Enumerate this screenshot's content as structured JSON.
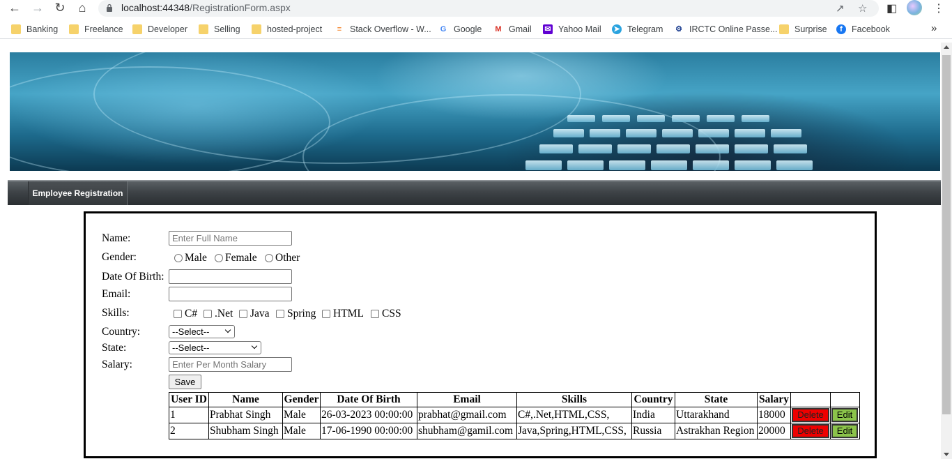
{
  "browser": {
    "url_host": "localhost:44348",
    "url_path": "/RegistrationForm.aspx",
    "bookmarks": [
      {
        "label": "Banking",
        "icon": "folder-icon"
      },
      {
        "label": "Freelance",
        "icon": "folder-icon"
      },
      {
        "label": "Developer",
        "icon": "folder-icon"
      },
      {
        "label": "Selling",
        "icon": "folder-icon"
      },
      {
        "label": "hosted-project",
        "icon": "folder-icon"
      },
      {
        "label": "Stack Overflow - W...",
        "icon": "stackoverflow-icon"
      },
      {
        "label": "Google",
        "icon": "google-icon"
      },
      {
        "label": "Gmail",
        "icon": "gmail-icon"
      },
      {
        "label": "Yahoo Mail",
        "icon": "yahoo-mail-icon"
      },
      {
        "label": "Telegram",
        "icon": "telegram-icon"
      },
      {
        "label": "IRCTC Online Passe...",
        "icon": "irctc-icon"
      },
      {
        "label": "Surprise",
        "icon": "folder-icon"
      },
      {
        "label": "Facebook",
        "icon": "facebook-icon"
      }
    ],
    "more_label": "»"
  },
  "menu": {
    "item": "Employee Registration"
  },
  "form": {
    "name_label": "Name:",
    "name_placeholder": "Enter Full Name",
    "gender_label": "Gender:",
    "gender_options": [
      "Male",
      "Female",
      "Other"
    ],
    "dob_label": "Date Of Birth:",
    "email_label": "Email:",
    "skills_label": "Skills:",
    "skills_options": [
      "C#",
      ".Net",
      "Java",
      "Spring",
      "HTML",
      "CSS"
    ],
    "country_label": "Country:",
    "country_value": "--Select--",
    "state_label": "State:",
    "state_value": "--Select--",
    "salary_label": "Salary:",
    "salary_placeholder": "Enter Per Month Salary",
    "save_label": "Save"
  },
  "table": {
    "headers": [
      "User ID",
      "Name",
      "Gender",
      "Date Of Birth",
      "Email",
      "Skills",
      "Country",
      "State",
      "Salary",
      "",
      ""
    ],
    "rows": [
      {
        "id": "1",
        "name": "Prabhat Singh",
        "gender": "Male",
        "dob": "26-03-2023 00:00:00",
        "email": "prabhat@gmail.com",
        "skills": "C#,.Net,HTML,CSS,",
        "country": "India",
        "state": "Uttarakhand",
        "salary": "18000",
        "delete": "Delete",
        "edit": "Edit"
      },
      {
        "id": "2",
        "name": "Shubham Singh",
        "gender": "Male",
        "dob": "17-06-1990 00:00:00",
        "email": "shubham@gamil.com",
        "skills": "Java,Spring,HTML,CSS,",
        "country": "Russia",
        "state": "Astrakhan Region",
        "salary": "20000",
        "delete": "Delete",
        "edit": "Edit"
      }
    ]
  },
  "colors": {
    "delete_button": "#ee0000",
    "edit_button": "#8bc34a",
    "menubar": "#3e4347",
    "banner": "#2b7ea0"
  }
}
